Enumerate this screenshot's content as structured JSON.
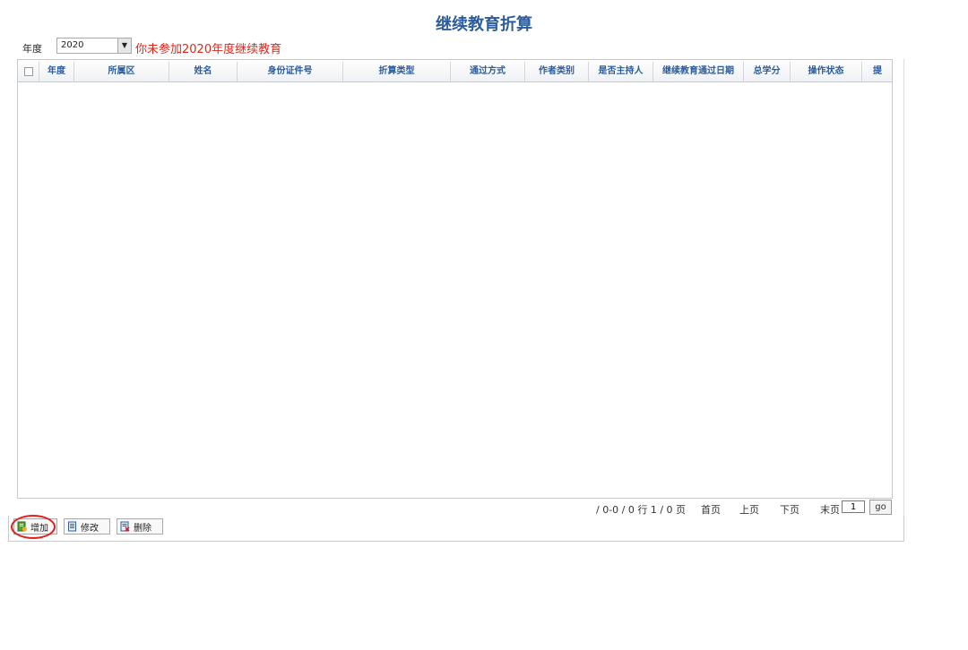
{
  "page": {
    "title": "继续教育折算"
  },
  "filter": {
    "year_label": "年度",
    "year_value": "2020",
    "notice": "你未参加2020年度继续教育",
    "notice_color": "#e0261a"
  },
  "grid": {
    "columns": [
      {
        "label": "年度"
      },
      {
        "label": "所属区"
      },
      {
        "label": "姓名"
      },
      {
        "label": "身份证件号"
      },
      {
        "label": "折算类型"
      },
      {
        "label": "通过方式"
      },
      {
        "label": "作者类别"
      },
      {
        "label": "是否主持人"
      },
      {
        "label": "继续教育通过日期"
      },
      {
        "label": "总学分"
      },
      {
        "label": "操作状态"
      },
      {
        "label": "提"
      }
    ],
    "rows": []
  },
  "pager": {
    "info": "/ 0-0 / 0 行 1 / 0 页",
    "first": "首页",
    "prev": "上页",
    "next": "下页",
    "last": "末页",
    "page_value": "1",
    "go": "go"
  },
  "toolbar": {
    "add": "增加",
    "edit": "修改",
    "delete": "删除"
  },
  "colors": {
    "accent": "#2b5c9e",
    "highlight": "#e02020"
  }
}
